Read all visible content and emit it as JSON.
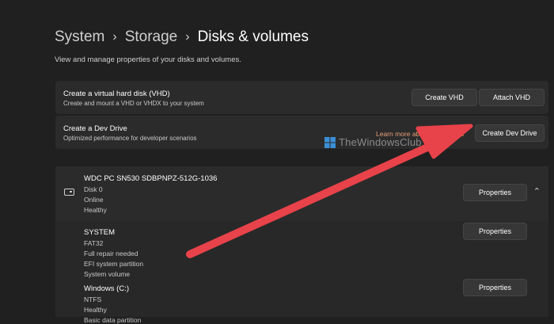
{
  "breadcrumb": {
    "system": "System",
    "storage": "Storage",
    "current": "Disks & volumes"
  },
  "subtitle": "View and manage properties of your disks and volumes.",
  "vhd_card": {
    "title": "Create a virtual hard disk (VHD)",
    "subtitle": "Create and mount a VHD or VHDX to your system",
    "create_button": "Create VHD",
    "attach_button": "Attach VHD"
  },
  "dev_card": {
    "title": "Create a Dev Drive",
    "subtitle": "Optimized performance for developer scenarios",
    "learn_link": "Learn more about Dev Drives",
    "create_button": "Create Dev Drive"
  },
  "disk": {
    "name": "WDC PC SN530 SDBPNPZ-512G-1036",
    "lines": [
      "Disk 0",
      "Online",
      "Healthy"
    ],
    "properties_button": "Properties"
  },
  "volumes": [
    {
      "name": "SYSTEM",
      "lines": [
        "FAT32",
        "Full repair needed",
        "EFI system partition",
        "System volume"
      ],
      "properties_button": "Properties"
    },
    {
      "name": "Windows (C:)",
      "lines": [
        "NTFS",
        "Healthy",
        "Basic data partition"
      ],
      "properties_button": "Properties"
    }
  ],
  "watermark": {
    "text": "TheWindowsClub"
  },
  "colors": {
    "background": "#202020",
    "card": "#2b2b2b",
    "link": "#e9a077",
    "arrow": "#e8424a"
  },
  "icons": {
    "drive": "drive-icon",
    "collapse": "chevron-up-icon",
    "separator": "chevron-right-icon"
  }
}
